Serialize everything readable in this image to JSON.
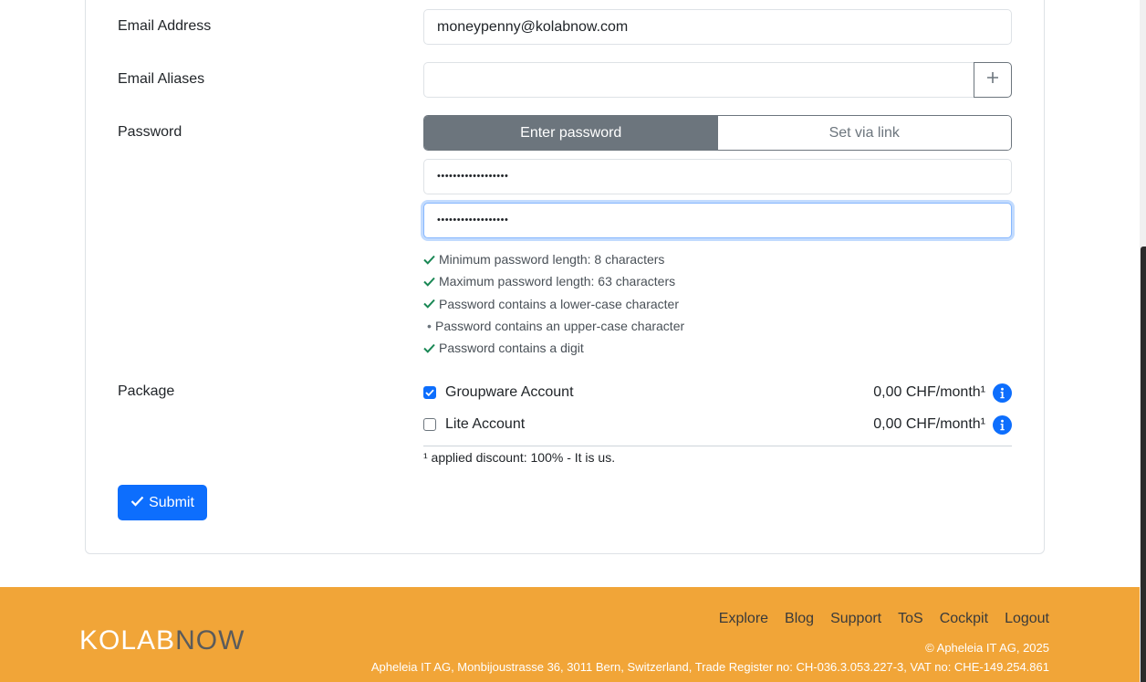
{
  "form": {
    "email_label": "Email Address",
    "email_value": "moneypenny@kolabnow.com",
    "aliases_label": "Email Aliases",
    "aliases_value": "",
    "password_label": "Password",
    "password_modes": [
      "Enter password",
      "Set via link"
    ],
    "password_value": "••••••••••••••••••",
    "password_confirm_value": "••••••••••••••••••",
    "password_rules": [
      {
        "text": "Minimum password length: 8 characters",
        "status": "passed"
      },
      {
        "text": "Maximum password length: 63 characters",
        "status": "passed"
      },
      {
        "text": "Password contains a lower-case character",
        "status": "passed"
      },
      {
        "text": "Password contains an upper-case character",
        "status": "pending"
      },
      {
        "text": "Password contains a digit",
        "status": "passed"
      }
    ],
    "package_label": "Package",
    "packages": [
      {
        "name": "Groupware Account",
        "price": "0,00 CHF/month¹",
        "checked": true
      },
      {
        "name": "Lite Account",
        "price": "0,00 CHF/month¹",
        "checked": false
      }
    ],
    "discount_note": "¹ applied discount: 100% - It is us.",
    "submit_label": "Submit"
  },
  "footer": {
    "logo_part1": "KOLAB",
    "logo_part2": "NOW",
    "nav": [
      "Explore",
      "Blog",
      "Support",
      "ToS",
      "Cockpit",
      "Logout"
    ],
    "copyright": "© Apheleia IT AG, 2025",
    "address": "Apheleia IT AG, Monbijoustrasse 36, 3011 Bern, Switzerland, Trade Register no: CH-036.3.053.227-3, VAT no: CHE-149.254.861"
  },
  "colors": {
    "primary": "#0d6efd",
    "secondary": "#6c757d",
    "success": "#198754",
    "footer_bg": "#f1a538"
  }
}
